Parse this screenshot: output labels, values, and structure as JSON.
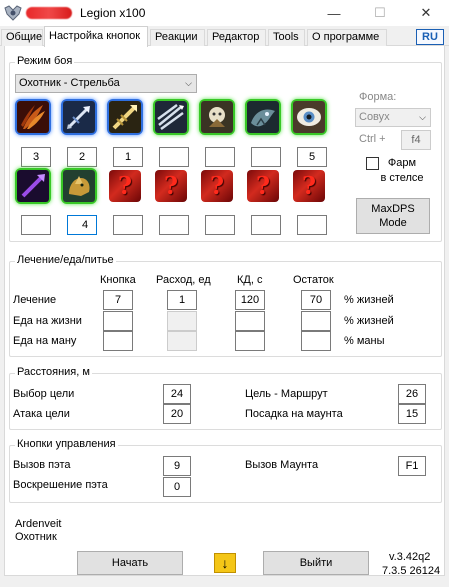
{
  "window": {
    "title": "Legion x100",
    "minimize": "—",
    "maximize": "☐",
    "close": "✕"
  },
  "tabs": [
    {
      "label": "Общие"
    },
    {
      "label": "Настройка кнопок"
    },
    {
      "label": "Реакции"
    },
    {
      "label": "Редактор"
    },
    {
      "label": "Tools"
    },
    {
      "label": "О программе"
    }
  ],
  "lang": "RU",
  "combat": {
    "title": "Режим боя",
    "spec": "Охотник - Стрельба",
    "form_label": "Форма:",
    "form_value": "Совух",
    "hotkey_label": "Ctrl +",
    "hotkey_value": "f4",
    "farm_label": "Фарм\nв стелсе",
    "maxdps_label": "MaxDPS\nMode",
    "row1": [
      {
        "icon": "feathers-icon",
        "key": "3"
      },
      {
        "icon": "arrow-shot-icon",
        "key": "2"
      },
      {
        "icon": "golden-arrow-icon",
        "key": "1"
      },
      {
        "icon": "multi-shot-icon",
        "key": ""
      },
      {
        "icon": "hunter-mark-icon",
        "key": ""
      },
      {
        "icon": "beast-icon",
        "key": ""
      },
      {
        "icon": "eye-icon",
        "key": "5"
      }
    ],
    "row2": [
      {
        "icon": "purple-arrow-icon",
        "key": ""
      },
      {
        "icon": "pet-icon",
        "key": "4"
      },
      {
        "icon": "unknown-icon",
        "key": ""
      },
      {
        "icon": "unknown-icon",
        "key": ""
      },
      {
        "icon": "unknown-icon",
        "key": ""
      },
      {
        "icon": "unknown-icon",
        "key": ""
      },
      {
        "icon": "unknown-icon",
        "key": ""
      }
    ]
  },
  "heal": {
    "title": "Лечение/еда/питье",
    "headers": {
      "button": "Кнопка",
      "consumption": "Расход, ед",
      "cooldown": "КД, с",
      "remain": "Остаток"
    },
    "rows": [
      {
        "label": "Лечение",
        "button": "7",
        "consumption": "1",
        "cooldown": "120",
        "remain": "70",
        "unit": "% жизней"
      },
      {
        "label": "Еда на жизни",
        "button": "",
        "consumption": "",
        "cooldown": "",
        "remain": "",
        "unit": "% жизней"
      },
      {
        "label": "Еда на ману",
        "button": "",
        "consumption": "",
        "cooldown": "",
        "remain": "",
        "unit": "% маны"
      }
    ]
  },
  "distances": {
    "title": "Расстояния, м",
    "target_select_label": "Выбор цели",
    "target_select": "24",
    "attack_target_label": "Атака цели",
    "attack_target": "20",
    "route_label": "Цель - Маршрут",
    "route": "26",
    "mount_landing_label": "Посадка на маунта",
    "mount_landing": "15"
  },
  "controls": {
    "title": "Кнопки управления",
    "call_pet_label": "Вызов пэта",
    "call_pet": "9",
    "revive_pet_label": "Воскрешение пэта",
    "revive_pet": "0",
    "call_mount_label": "Вызов Маунта",
    "call_mount": "F1"
  },
  "footer": {
    "character_name": "Ardenveit",
    "character_class": "Охотник",
    "start": "Начать",
    "download_icon": "↓",
    "exit": "Выйти",
    "version": "v.3.42q2",
    "build": "7.3.5 26124"
  }
}
